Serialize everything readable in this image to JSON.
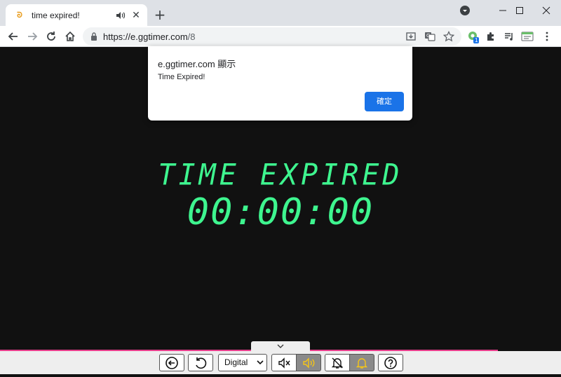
{
  "browser": {
    "tab_title": "time expired!",
    "tab_close": "✕",
    "new_tab": "+",
    "url_host": "https://e.ggtimer.com",
    "url_path": "/8",
    "extension_badge": "1"
  },
  "dialog": {
    "title": "e.ggtimer.com 顯示",
    "message": "Time Expired!",
    "ok_label": "確定"
  },
  "timer": {
    "status": "TIME EXPIRED",
    "time": "00:00:00"
  },
  "controls": {
    "display_mode": "Digital",
    "sound_on": true,
    "alarm_on": true
  },
  "colors": {
    "timer_text": "#3ef58f",
    "progress_bar": "#e83e8c",
    "ok_button": "#1a73e8",
    "active_icon": "#f5c518"
  }
}
